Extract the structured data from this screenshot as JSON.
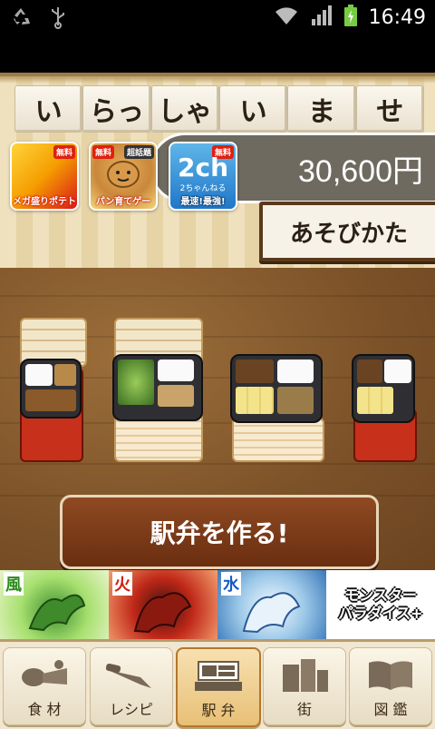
{
  "statusbar": {
    "time": "16:49"
  },
  "header": {
    "title_chars": [
      "い",
      "らっ",
      "しゃ",
      "い",
      "ま",
      "せ"
    ],
    "money": "30,600円",
    "howto_label": "あそびかた",
    "apps": [
      {
        "badge": "無料",
        "label": "メガ盛りポテト"
      },
      {
        "badge": "無料",
        "label": "パン育てゲー",
        "extra": "超話題"
      },
      {
        "badge": "無料",
        "title": "2ch",
        "sub": "2ちゃんねる",
        "label": "最速!最強!"
      }
    ]
  },
  "main": {
    "make_button": "駅弁を作る!"
  },
  "banner": {
    "items": [
      {
        "tag": "風"
      },
      {
        "tag": "火"
      },
      {
        "tag": "水"
      },
      {
        "title_line1": "モンスター",
        "title_line2": "パラダイス+"
      }
    ]
  },
  "navbar": {
    "items": [
      {
        "label": "食 材",
        "icon": "meat-icon"
      },
      {
        "label": "レシピ",
        "icon": "knife-icon"
      },
      {
        "label": "駅 弁",
        "icon": "bento-icon"
      },
      {
        "label": "街",
        "icon": "building-icon"
      },
      {
        "label": "図 鑑",
        "icon": "book-icon"
      }
    ],
    "active_index": 2
  },
  "colors": {
    "button": "#7a3a18",
    "wood": "#7b5128",
    "header": "#efe1bd"
  }
}
